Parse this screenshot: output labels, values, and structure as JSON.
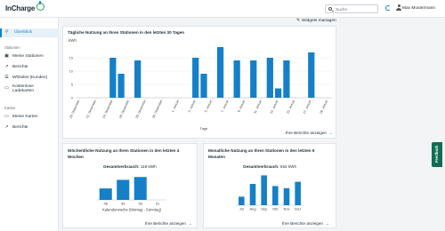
{
  "app": {
    "logo": "InCharge"
  },
  "header": {
    "search_placeholder": "Suche",
    "user_name": "Max Mustermann"
  },
  "sidebar": {
    "overview": "Überblick",
    "section_stations": "Stationen",
    "items_stations": [
      {
        "label": "Meine Stationen",
        "icon": "charger-icon"
      },
      {
        "label": "Berichte",
        "icon": "trend-icon"
      },
      {
        "label": "Whitelist (Kunden)",
        "icon": "list-icon"
      },
      {
        "label": "Kostenlose Ladekarten",
        "icon": "card-icon"
      }
    ],
    "section_cards": "Karten",
    "items_cards": [
      {
        "label": "Meine Karten",
        "icon": "card-icon"
      },
      {
        "label": "Berichte",
        "icon": "trend-icon"
      }
    ]
  },
  "toolbar": {
    "manage_widgets": "Widgets managen"
  },
  "daily_widget": {
    "title": "Tägliche Nutzung an Ihren Stationen in den letzten 30 Tagen",
    "more": "Ihre Berichte anzeigen"
  },
  "weekly_widget": {
    "title": "Wöchentliche Nutzung an Ihren Stationen in den letzten 4 Wochen",
    "total_label": "Gesamtverbrauch:",
    "total_value": "119 kWh",
    "more": "Ihre Berichte anzeigen"
  },
  "monthly_widget": {
    "title": "Monatliche Nutzung an Ihren Stationen in den letzten 6 Monaten",
    "total_label": "Gesamtverbrauch:",
    "total_value": "564 kWh",
    "more": "Ihre Berichte anzeigen"
  },
  "feedback": "Feedback",
  "colors": {
    "accent": "#1580c8",
    "bar": "#1580c8",
    "logo_ring": "#2aa84a"
  },
  "chart_data": [
    {
      "type": "bar",
      "ylabel": "kWh",
      "xlabel": "Tage",
      "ylim": [
        0,
        20
      ],
      "yticks": [
        0,
        5,
        10,
        15
      ],
      "categories": [
        "20. Dezember",
        "22. Dezember",
        "24. Dezember",
        "26. Dezember",
        "28. Dezember",
        "30. Dezember",
        "1. Januar",
        "3. Januar",
        "5. Januar",
        "7. Januar",
        "9. Januar",
        "11. Januar",
        "13. Januar",
        "15. Januar",
        "17. Januar",
        "19. Januar"
      ],
      "bar_days": [
        4,
        5,
        7,
        14,
        15,
        17,
        19,
        21,
        23,
        24,
        25,
        28
      ],
      "values": [
        15,
        9,
        14,
        15,
        9,
        19,
        14,
        14,
        15,
        3.5,
        14,
        17
      ],
      "day_count": 31,
      "label_every": 2
    },
    {
      "type": "bar",
      "xlabel": "Kalenderwoche (Montag - Sonntag)",
      "categories": [
        "48",
        "49",
        "50",
        "51"
      ],
      "values": [
        20,
        35,
        40,
        0
      ],
      "ylim": [
        0,
        45
      ]
    },
    {
      "type": "bar",
      "categories": [
        "Jul",
        "Aug",
        "Sep",
        "Okt",
        "Nov",
        "Dez"
      ],
      "values": [
        40,
        100,
        140,
        90,
        80,
        110
      ],
      "ylim": [
        0,
        150
      ]
    }
  ]
}
